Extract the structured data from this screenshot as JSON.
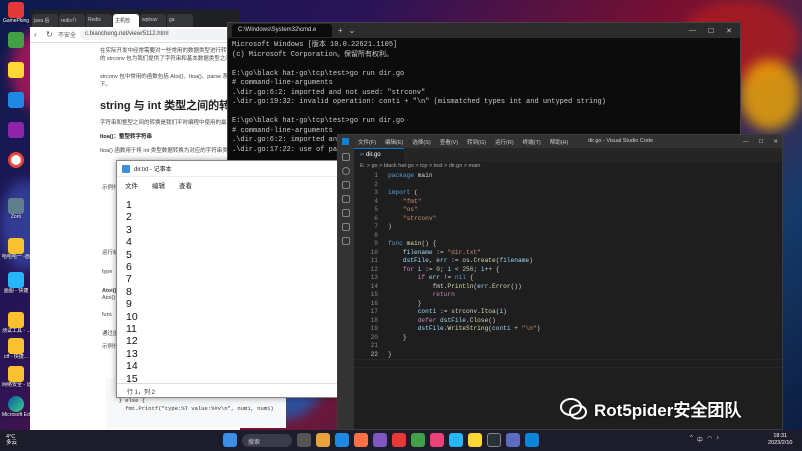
{
  "desktop": {
    "icons": [
      {
        "label": "GamePking"
      },
      {
        "label": ""
      },
      {
        "label": ""
      },
      {
        "label": ""
      },
      {
        "label": ""
      },
      {
        "label": ""
      },
      {
        "label": "Zoro"
      },
      {
        "label": "哈哈哈一 -面..."
      },
      {
        "label": "画图 - 快捷"
      },
      {
        "label": "测试工具 - ..."
      },
      {
        "label": ""
      },
      {
        "label": "ctf - 快捷..."
      },
      {
        "label": "网络安全 - 运营教育..."
      },
      {
        "label": "Microsoft Edge"
      }
    ]
  },
  "browser": {
    "tabs": [
      "java 后",
      "redis介",
      "Redis",
      "主机检",
      "wplnav",
      "ga"
    ],
    "security_label": "不安全",
    "url": "c.biancheng.net/view/5112.html",
    "content": {
      "intro1": "在实际开发中经常需要对一些常用的数据类型进行转换，如 string、int、",
      "intro2": "的 strconv 包为我们提供了字符串和基本数据类型之间的转换功能。",
      "intro3": "strconv 包中常用的函数包括 Atoi()、Itoa()、parse 系列函数、forma",
      "intro4": "下。",
      "heading": "string 与 int 类型之间的转换",
      "para1": "字符串和整型之间的转换是我们平时编程中使用的最多的，下面就来介",
      "itoa_title": "Itoa()：整型转字符串",
      "itoa_desc": "Itoa() 函数用于将 int 类型数据转换为对应的字符串类型，函数签名如",
      "example1": "示例代码如",
      "run_result": "运行结果",
      "type_label": "type",
      "atoi_title": "Atoi()：",
      "atoi_desc": "Atoi() 函",
      "func_label": "func",
      "atoi_note": "通过函数",
      "example2": "示例代码"
    },
    "code_snippet": "  if err != nil {\n    fmt.Printf(\"%v 转换失败！\", str1)\n  } else {\n    fmt.Printf(\"type:%T value:%#v\\n\", num1, num1)"
  },
  "notepad": {
    "title": "dir.txt - 记事本",
    "menu": [
      "文件",
      "编辑",
      "查看"
    ],
    "lines": [
      "1",
      "2",
      "3",
      "4",
      "5",
      "6",
      "7",
      "8",
      "9",
      "10",
      "11",
      "12",
      "13",
      "14",
      "15",
      "16"
    ],
    "status": "行 1，列 2"
  },
  "cmd": {
    "tab_title": "C:\\Windows\\System32\\cmd.e",
    "output": "Microsoft Windows [版本 10.0.22621.1105]\n(c) Microsoft Corporation。保留所有权利。\n\nE:\\go\\black hat-go\\tcp\\test>go run dir.go\n# command-line-arguments\n.\\dir.go:6:2: imported and not used: \"strconv\"\n.\\dir.go:19:32: invalid operation: conti + \"\\n\" (mismatched types int and untyped string)\n\nE:\\go\\black hat-go\\tcp\\test>go run dir.go\n# command-line-arguments\n.\\dir.go:6:2: imported and not used: \"strconv\"\n.\\dir.go:17:22: use of package strconv without selector\n\nE:\\go\\black hat-go\\tcp\\test>g\n# command-line-arguments\n.\\dir.go:6:2: imported and not\n.\\dir.go:17:22: use of package\n\nE:\\go\\black hat-go\\tcp\\test>g\n\nE:\\go\\black hat-go\\tcp\\test>"
  },
  "vscode": {
    "menu": [
      "文件(F)",
      "编辑(E)",
      "选择(S)",
      "查看(V)",
      "转到(G)",
      "运行(R)",
      "终端(T)",
      "帮助(H)"
    ],
    "window_title": "dir.go - Visual Studio Code",
    "tab": "dir.go",
    "breadcrumb": "E: > go > black hat-go > tcp > test > dir.go > main",
    "line_numbers": [
      "1",
      "2",
      "3",
      "4",
      "5",
      "6",
      "7",
      "8",
      "9",
      "10",
      "11",
      "12",
      "13",
      "14",
      "15",
      "16",
      "17",
      "18",
      "19",
      "20",
      "21",
      "22"
    ]
  },
  "watermark": {
    "text": "Rot5pider安全团队"
  },
  "taskbar": {
    "weather_temp": "4°C",
    "weather_desc": "多云",
    "search_placeholder": "搜索",
    "tray_ime": "中",
    "time": "18:31",
    "date": "2023/2/10"
  }
}
